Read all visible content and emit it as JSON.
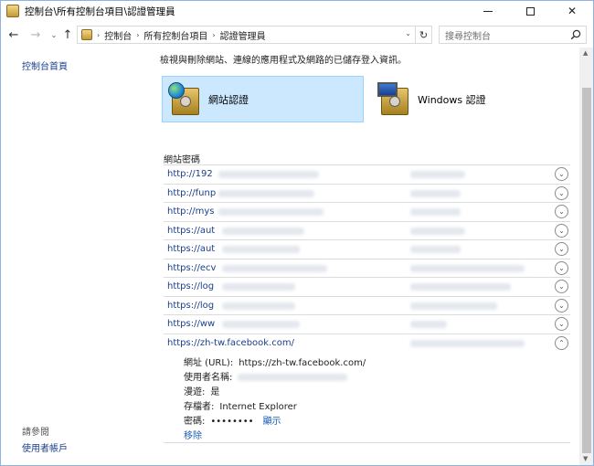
{
  "window": {
    "title": "控制台\\所有控制台項目\\認證管理員"
  },
  "address_bar": {
    "crumbs": [
      "控制台",
      "所有控制台項目",
      "認證管理員"
    ],
    "search_placeholder": "搜尋控制台"
  },
  "left_pane": {
    "home_link": "控制台首頁",
    "see_also": "請參閱",
    "user_accounts": "使用者帳戶"
  },
  "main": {
    "intro": "檢視與刪除網站、連線的應用程式及網路的已儲存登入資訊。",
    "tabs": {
      "web": "網站認證",
      "windows": "Windows 認證"
    },
    "section_title": "網站密碼",
    "rows": [
      {
        "url": "http://192"
      },
      {
        "url": "http://funp"
      },
      {
        "url": "http://mys"
      },
      {
        "url": "https://aut"
      },
      {
        "url": "https://aut"
      },
      {
        "url": "https://ecv"
      },
      {
        "url": "https://log"
      },
      {
        "url": "https://log"
      },
      {
        "url": "https://ww"
      },
      {
        "url": "https://zh-tw.facebook.com/"
      }
    ],
    "details": {
      "url_label": "網址 (URL):",
      "url_value": "https://zh-tw.facebook.com/",
      "username_label": "使用者名稱:",
      "roaming_label": "漫遊:",
      "roaming_value": "是",
      "saved_by_label": "存檔者:",
      "saved_by_value": "Internet Explorer",
      "password_label": "密碼:",
      "password_value": "••••••••",
      "show_link": "顯示",
      "remove_link": "移除"
    }
  },
  "colors": {
    "link": "#1a3f8c",
    "selected_tab_bg": "#cce8ff",
    "selected_tab_border": "#99d1ff"
  }
}
